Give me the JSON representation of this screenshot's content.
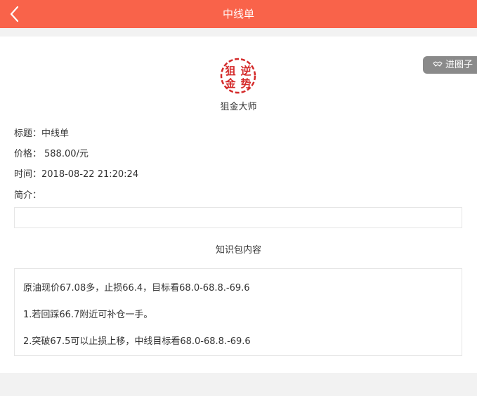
{
  "header": {
    "title": "中线单"
  },
  "join_button": {
    "label": "进圈子",
    "icon": "handshake-icon"
  },
  "author": {
    "name": "狙金大师",
    "logo_text": [
      "狙",
      "逆",
      "金",
      "势"
    ],
    "logo_color": "#d42a2a"
  },
  "info": {
    "title_label": "标题：",
    "title_value": "中线单",
    "price_label": "价格：",
    "price_value": "588.00/元",
    "time_label": "时间：",
    "time_value": "2018-08-22 21:20:24",
    "intro_label": "简介：",
    "intro_value": ""
  },
  "content": {
    "section_title": "知识包内容",
    "lines": [
      "原油现价67.08多，止损66.4，目标看68.0-68.8.-69.6",
      "1.若回踩66.7附近可补仓一手。",
      "2.突破67.5可以止损上移，中线目标看68.0-68.8.-69.6"
    ]
  },
  "colors": {
    "header": "#f9634a",
    "join_button": "#8a8a8a"
  }
}
